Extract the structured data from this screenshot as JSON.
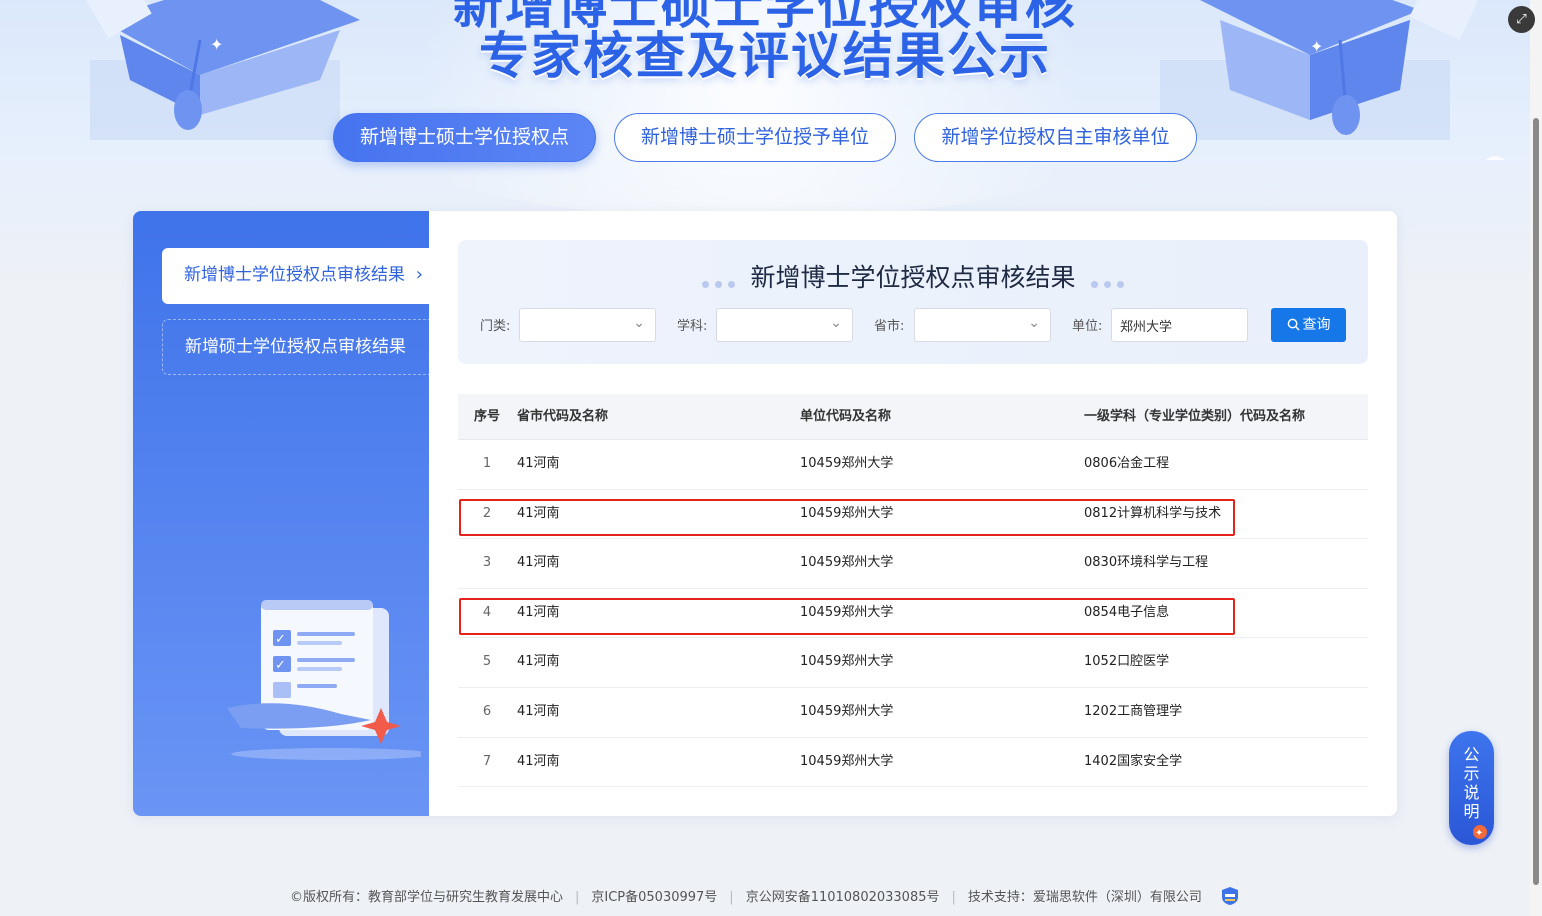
{
  "hero": {
    "title_partial": "新增博士硕士学位授权审核",
    "title": "专家核查及评议结果公示"
  },
  "top_tabs": [
    {
      "label": "新增博士硕士学位授权点",
      "active": true
    },
    {
      "label": "新增博士硕士学位授予单位",
      "active": false
    },
    {
      "label": "新增学位授权自主审核单位",
      "active": false
    }
  ],
  "sidebar": {
    "items": [
      {
        "label": "新增博士学位授权点审核结果",
        "active": true
      },
      {
        "label": "新增硕士学位授权点审核结果",
        "active": false
      }
    ],
    "chevron": "›"
  },
  "panel": {
    "title": "新增博士学位授权点审核结果"
  },
  "filters": {
    "category_label": "门类:",
    "subject_label": "学科:",
    "province_label": "省市:",
    "unit_label": "单位:",
    "unit_value": "郑州大学",
    "query_label": "查询"
  },
  "table": {
    "headers": [
      "序号",
      "省市代码及名称",
      "单位代码及名称",
      "一级学科（专业学位类别）代码及名称"
    ],
    "rows": [
      {
        "no": "1",
        "province": "41河南",
        "unit": "10459郑州大学",
        "subject": "0806冶金工程",
        "highlight": false
      },
      {
        "no": "2",
        "province": "41河南",
        "unit": "10459郑州大学",
        "subject": "0812计算机科学与技术",
        "highlight": true
      },
      {
        "no": "3",
        "province": "41河南",
        "unit": "10459郑州大学",
        "subject": "0830环境科学与工程",
        "highlight": false
      },
      {
        "no": "4",
        "province": "41河南",
        "unit": "10459郑州大学",
        "subject": "0854电子信息",
        "highlight": true
      },
      {
        "no": "5",
        "province": "41河南",
        "unit": "10459郑州大学",
        "subject": "1052口腔医学",
        "highlight": false
      },
      {
        "no": "6",
        "province": "41河南",
        "unit": "10459郑州大学",
        "subject": "1202工商管理学",
        "highlight": false
      },
      {
        "no": "7",
        "province": "41河南",
        "unit": "10459郑州大学",
        "subject": "1402国家安全学",
        "highlight": false
      }
    ]
  },
  "notice_button": {
    "chars": [
      "公",
      "示",
      "说",
      "明"
    ]
  },
  "footer": {
    "copyright": "©版权所有：教育部学位与研究生教育发展中心",
    "icp": "京ICP备05030997号",
    "police": "京公网安备11010802033085号",
    "tech": "技术支持：爱瑞思软件（深圳）有限公司",
    "separator": "|"
  },
  "colors": {
    "primary": "#2f62dd",
    "accent_button": "#1677e8",
    "highlight_border": "#e5231c",
    "sidebar_top": "#3f73ea"
  },
  "icons": [
    "search-icon",
    "chevron-right-icon",
    "chevron-down-icon",
    "expand-icon",
    "gov-badge-icon"
  ]
}
